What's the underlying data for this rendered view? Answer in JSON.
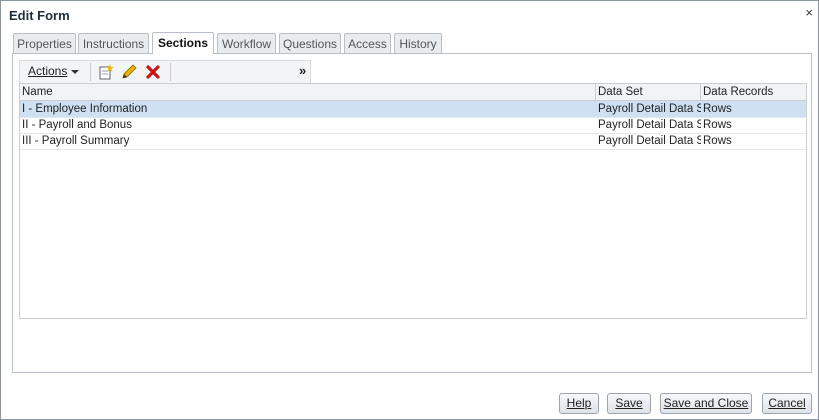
{
  "dialog": {
    "title": "Edit Form",
    "close_glyph": "×"
  },
  "tabs": [
    {
      "label": "Properties"
    },
    {
      "label": "Instructions"
    },
    {
      "label": "Sections",
      "active": true
    },
    {
      "label": "Workflow"
    },
    {
      "label": "Questions"
    },
    {
      "label": "Access"
    },
    {
      "label": "History"
    }
  ],
  "toolbar": {
    "actions_label": "Actions",
    "icons": [
      "add-icon",
      "edit-icon",
      "delete-icon"
    ],
    "more_glyph": "»"
  },
  "table": {
    "columns": [
      "Name",
      "Data Set",
      "Data Records"
    ],
    "rows": [
      {
        "name": "I - Employee Information",
        "data_set": "Payroll Detail Data Set",
        "data_records": "Rows",
        "selected": true
      },
      {
        "name": "II - Payroll and Bonus",
        "data_set": "Payroll Detail Data Set",
        "data_records": "Rows"
      },
      {
        "name": "III - Payroll Summary",
        "data_set": "Payroll Detail Data Set",
        "data_records": "Rows"
      }
    ]
  },
  "buttons": {
    "help": "Help",
    "save": "Save",
    "save_close": "Save and Close",
    "cancel": "Cancel"
  },
  "colors": {
    "selected_row": "#cfe0f3",
    "delete_icon": "#cc1111",
    "edit_icon": "#d9a300"
  }
}
